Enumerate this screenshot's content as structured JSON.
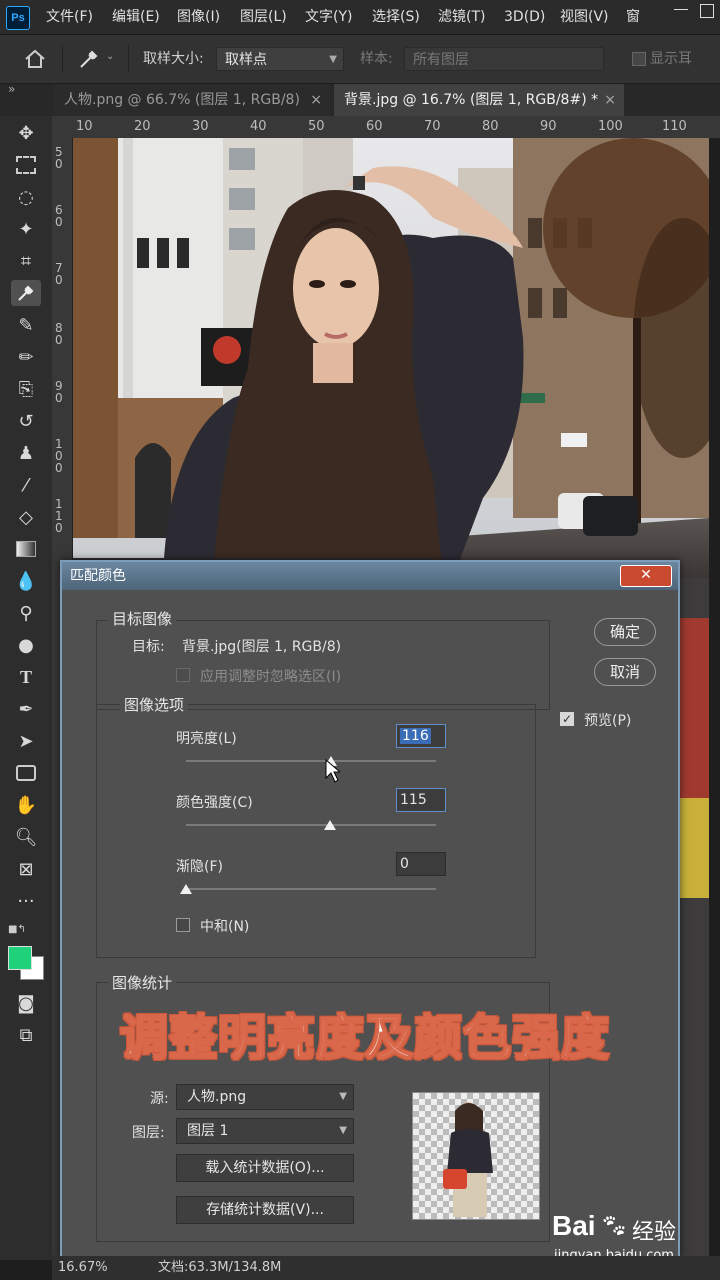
{
  "menubar": {
    "logo": "Ps",
    "items": [
      "文件(F)",
      "编辑(E)",
      "图像(I)",
      "图层(L)",
      "文字(Y)",
      "选择(S)",
      "滤镜(T)",
      "3D(D)",
      "视图(V)",
      "窗"
    ]
  },
  "options": {
    "sample_size_label": "取样大小:",
    "sample_size_value": "取样点",
    "sample_label": "样本:",
    "sample_value": "所有图层",
    "show_ring_label": "显示耳"
  },
  "tabs": [
    {
      "label": "人物.png @ 66.7% (图层 1, RGB/8)",
      "close": "×",
      "active": false
    },
    {
      "label": "背景.jpg @ 16.7% (图层 1, RGB/8#) *",
      "close": "×",
      "active": true
    }
  ],
  "ruler": {
    "top": [
      "10",
      "20",
      "30",
      "40",
      "50",
      "60",
      "70",
      "80",
      "90",
      "100",
      "110"
    ],
    "left": [
      "50",
      "60",
      "70",
      "80",
      "90",
      "100",
      "110"
    ]
  },
  "status": {
    "zoom": "16.67%",
    "doc": "文档:63.3M/134.8M"
  },
  "dialog": {
    "title": "匹配颜色",
    "close": "✕",
    "target_group": "目标图像",
    "target_label": "目标:",
    "target_value": "背景.jpg(图层 1, RGB/8)",
    "ignore_selection": "应用调整时忽略选区(I)",
    "options_group": "图像选项",
    "luminance_label": "明亮度(L)",
    "luminance_value": "116",
    "luminance_level": 116,
    "intensity_label": "颜色强度(C)",
    "intensity_value": "115",
    "intensity_level": 115,
    "fade_label": "渐隐(F)",
    "fade_value": "0",
    "fade_level": 0,
    "neutralize": "中和(N)",
    "stats_group": "图像统计",
    "source_label": "源:",
    "source_value": "人物.png",
    "layer_label": "图层:",
    "layer_value": "图层 1",
    "load_stats": "载入统计数据(O)...",
    "save_stats": "存储统计数据(V)...",
    "ok": "确定",
    "cancel": "取消",
    "preview": "预览(P)",
    "preview_checked": true
  },
  "overlay": {
    "caption": "调整明亮度及颜色强度"
  },
  "watermark": {
    "brand": "Bai",
    "brand2": "经验",
    "url": "jingyan.baidu.com"
  }
}
